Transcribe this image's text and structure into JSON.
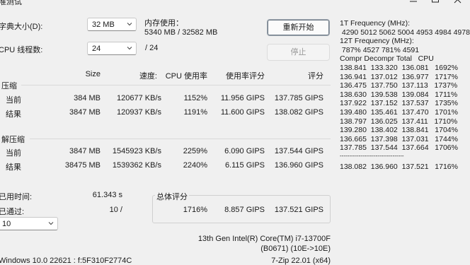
{
  "window": {
    "title": "准测试"
  },
  "controls": {
    "dict_label": "字典大小(D):",
    "dict_value": "32 MB",
    "threads_label": "CPU 线程数:",
    "threads_value": "24",
    "threads_total": "/ 24",
    "mem_label": "内存使用：",
    "mem_value": "5340 MB / 32582 MB",
    "restart_label": "重新开始",
    "stop_label": "停止"
  },
  "table": {
    "headers": {
      "size": "Size",
      "speed": "速度:",
      "cpu": "CPU 使用率",
      "rating_per_use": "使用率评分",
      "rating": "评分"
    },
    "compress": {
      "title": "压缩",
      "rows": [
        {
          "label": "当前",
          "size": "384 MB",
          "speed": "120677 KB/s",
          "cpu": "1152%",
          "rpu": "11.956 GIPS",
          "rating": "137.785 GIPS"
        },
        {
          "label": "结果",
          "size": "3847 MB",
          "speed": "120937 KB/s",
          "cpu": "1191%",
          "rpu": "11.600 GIPS",
          "rating": "138.082 GIPS"
        }
      ]
    },
    "decompress": {
      "title": "解压缩",
      "rows": [
        {
          "label": "当前",
          "size": "3847 MB",
          "speed": "1545923 KB/s",
          "cpu": "2259%",
          "rpu": "6.090 GIPS",
          "rating": "137.544 GIPS"
        },
        {
          "label": "结果",
          "size": "38475 MB",
          "speed": "1539362 KB/s",
          "cpu": "2240%",
          "rpu": "6.115 GIPS",
          "rating": "136.960 GIPS"
        }
      ]
    }
  },
  "bottom": {
    "elapsed_label": "已用时间:",
    "elapsed_value": "61.343 s",
    "passes_label": "已通过:",
    "passes_value": "10 /",
    "passes_select": "10",
    "total_label": "总体评分",
    "total_cpu": "1716%",
    "total_rpu": "8.857 GIPS",
    "total_rating": "137.521 GIPS",
    "cpu_name": "13th Gen Intel(R) Core(TM) i7-13700F",
    "cpu_id": "(B0671) (10E->10E)",
    "windows": "Windows 10.0 22621 : f:5F310F2774C",
    "version": "7-Zip 22.01 (x64)"
  },
  "stats": {
    "freq1_title": "1T Frequency (MHz):",
    "freq1_values": " 4290 5012 5062 5004 4953 4984 4978",
    "freq12_title": "12T Frequency (MHz):",
    "freq12_values": " 787% 4527 781% 4591",
    "columns_header": "Compr Decompr Total   CPU",
    "rows": [
      "138.841  133.320  136.081   1692%",
      "136.941  137.012  136.977   1717%",
      "136.475  137.750  137.113   1737%",
      "138.630  139.538  139.084   1711%",
      "137.922  137.152  137.537   1735%",
      "139.480  135.461  137.470   1701%",
      "138.797  136.025  137.411   1710%",
      "139.280  138.402  138.841   1704%",
      "136.665  137.398  137.031   1744%",
      "137.785  137.544  137.664   1706%"
    ],
    "divider": "----------------------------------",
    "summary": "138.082  136.960  137.521   1716%"
  }
}
